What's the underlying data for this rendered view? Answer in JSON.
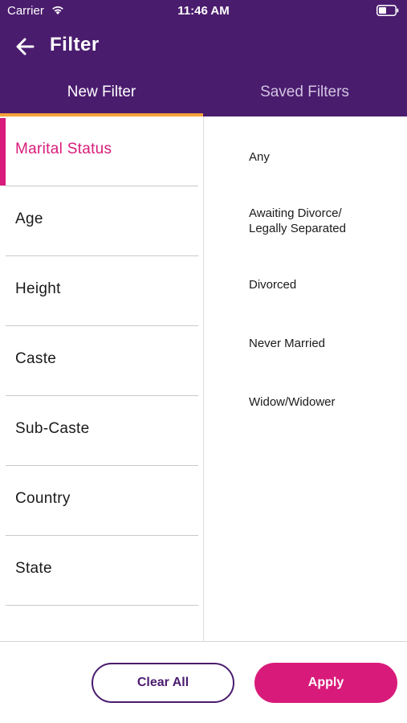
{
  "status_bar": {
    "carrier": "Carrier",
    "time": "11:46 AM"
  },
  "header": {
    "title": "Filter"
  },
  "tabs": [
    {
      "label": "New Filter",
      "active": true
    },
    {
      "label": "Saved Filters",
      "active": false
    }
  ],
  "categories": [
    {
      "label": "Marital Status",
      "active": true
    },
    {
      "label": "Age"
    },
    {
      "label": "Height"
    },
    {
      "label": "Caste"
    },
    {
      "label": "Sub-Caste"
    },
    {
      "label": "Country"
    },
    {
      "label": "State"
    }
  ],
  "options": [
    "Any",
    "Awaiting Divorce/\nLegally Separated",
    "Divorced",
    "Never Married",
    "Widow/Widower"
  ],
  "buttons": {
    "clear": "Clear All",
    "apply": "Apply"
  },
  "colors": {
    "header_bg": "#4a1c6e",
    "accent": "#d81b7a",
    "tab_indicator": "#f4a23a"
  }
}
